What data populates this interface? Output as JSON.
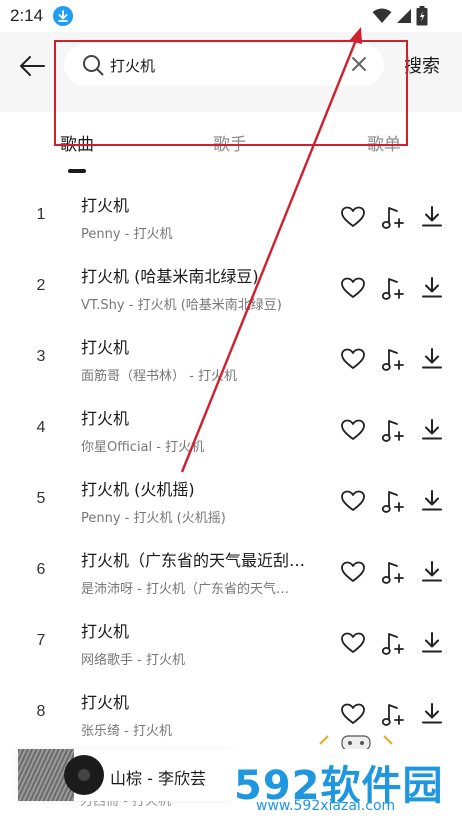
{
  "status_bar": {
    "time": "2:14",
    "icons": [
      "download-icon",
      "wifi-icon",
      "signal-icon",
      "battery-icon"
    ]
  },
  "search": {
    "query": "打火机",
    "submit_label": "搜索",
    "icons": [
      "back-arrow-icon",
      "search-icon",
      "clear-icon"
    ]
  },
  "tabs": [
    {
      "label": "歌曲",
      "active": true
    },
    {
      "label": "歌手",
      "active": false
    },
    {
      "label": "歌单",
      "active": false
    }
  ],
  "songs": [
    {
      "index": "1",
      "title": "打火机",
      "subtitle": "Penny - 打火机"
    },
    {
      "index": "2",
      "title": "打火机 (哈基米南北绿豆)",
      "subtitle": "VT.Shy - 打火机 (哈基米南北绿豆)"
    },
    {
      "index": "3",
      "title": "打火机",
      "subtitle": "面筋哥（程书林） - 打火机"
    },
    {
      "index": "4",
      "title": "打火机",
      "subtitle": "你星Official - 打火机"
    },
    {
      "index": "5",
      "title": "打火机 (火机摇)",
      "subtitle": "Penny - 打火机 (火机摇)"
    },
    {
      "index": "6",
      "title": "打火机（广东省的天气最近刮…",
      "subtitle": "是沛沛呀 - 打火机（广东省的天气…"
    },
    {
      "index": "7",
      "title": "打火机",
      "subtitle": "网络歌手 - 打火机"
    },
    {
      "index": "8",
      "title": "打火机",
      "subtitle": "张乐绮 - 打火机"
    }
  ],
  "song_actions": [
    "heart-icon",
    "add-to-playlist-icon",
    "download-icon"
  ],
  "mini_player": {
    "title": "山棕 - 李欣芸",
    "peek_text": "刃西冊 - 打火机"
  },
  "watermark": {
    "main": "592软件园",
    "url": "www.592xiazai.com"
  },
  "colors": {
    "accent_blue": "#1e9df2",
    "annotation_red": "#d0202e",
    "header_bg": "#f6f6f6",
    "watermark_blue": "#1f97e0"
  }
}
